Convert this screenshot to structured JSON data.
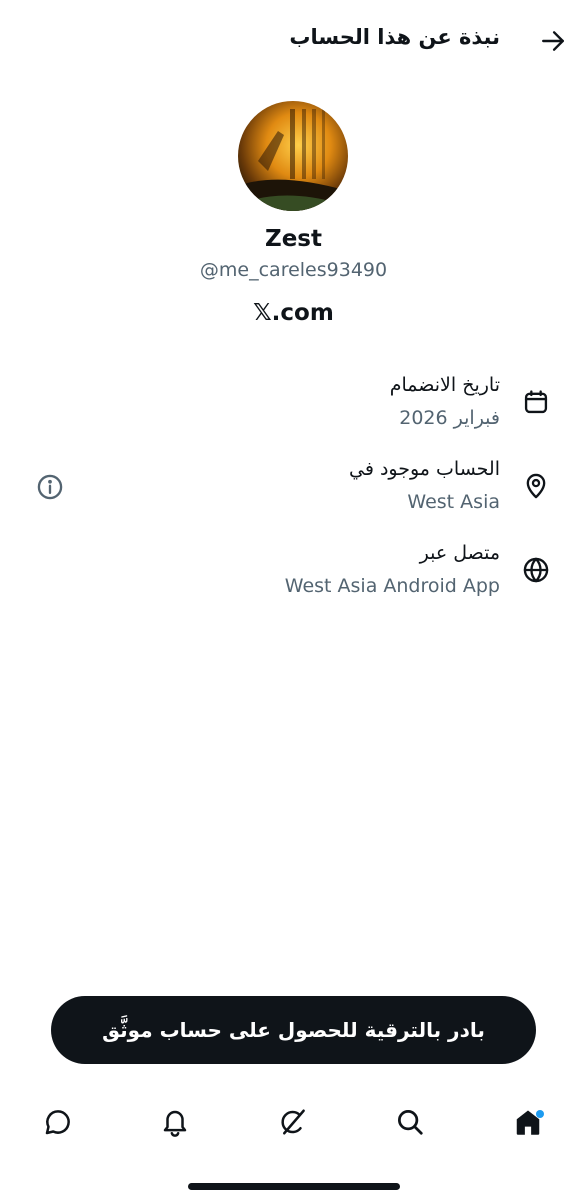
{
  "header": {
    "title": "نبذة عن هذا الحساب"
  },
  "profile": {
    "display_name": "Zest",
    "handle": "@me_careles93490",
    "platform": "𝕏.com"
  },
  "info": [
    {
      "icon": "calendar-icon",
      "label": "تاريخ الانضمام",
      "value": "فبراير 2026"
    },
    {
      "icon": "location-pin-icon",
      "label": "الحساب موجود في",
      "value": "West Asia"
    },
    {
      "icon": "globe-icon",
      "label": "متصل عبر",
      "value": "West Asia Android App"
    }
  ],
  "cta": {
    "label": "بادر بالترقية للحصول على حساب موثَّق"
  },
  "tabbar": {
    "items": [
      "home-icon",
      "search-icon",
      "grok-icon",
      "notifications-icon",
      "messages-icon"
    ],
    "active": "home-icon",
    "unread_dot_color": "#1d9bf0"
  },
  "colors": {
    "text": "#0f1419",
    "secondary": "#536471",
    "cta_bg": "#0f1419"
  }
}
